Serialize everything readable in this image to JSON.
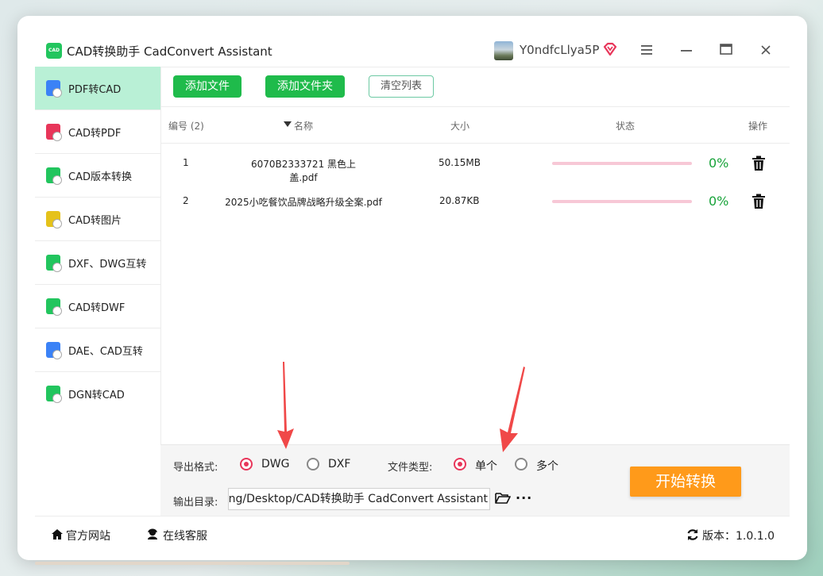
{
  "app": {
    "title": "CAD转换助手 CadConvert Assistant",
    "logo_text": "CAD",
    "username": "Y0ndfcLlya5P"
  },
  "sidebar": {
    "items": [
      {
        "label": "PDF转CAD",
        "icon": "pdf-to-cad-icon",
        "color": "#3b82f6",
        "active": true
      },
      {
        "label": "CAD转PDF",
        "icon": "cad-to-pdf-icon",
        "color": "#e8365a"
      },
      {
        "label": "CAD版本转换",
        "icon": "cad-version-icon",
        "color": "#22c55e"
      },
      {
        "label": "CAD转图片",
        "icon": "cad-to-image-icon",
        "color": "#e5c21a"
      },
      {
        "label": "DXF、DWG互转",
        "icon": "dxf-dwg-icon",
        "color": "#22c55e"
      },
      {
        "label": "CAD转DWF",
        "icon": "cad-to-dwf-icon",
        "color": "#22c55e"
      },
      {
        "label": "DAE、CAD互转",
        "icon": "dae-cad-icon",
        "color": "#3b82f6"
      },
      {
        "label": "DGN转CAD",
        "icon": "dgn-to-cad-icon",
        "color": "#22c55e"
      }
    ]
  },
  "toolbar": {
    "add_file": "添加文件",
    "add_folder": "添加文件夹",
    "clear_list": "清空列表"
  },
  "table": {
    "headers": {
      "index": "编号 (2)",
      "name": "名称",
      "size": "大小",
      "status": "状态",
      "action": "操作"
    },
    "rows": [
      {
        "index": "1",
        "name": "6070B2333721 黑色上盖.pdf",
        "size": "50.15MB",
        "progress": "0%"
      },
      {
        "index": "2",
        "name": "2025小吃餐饮品牌战略升级全案.pdf",
        "size": "20.87KB",
        "progress": "0%"
      }
    ]
  },
  "options": {
    "export_format_label": "导出格式:",
    "formats": [
      "DWG",
      "DXF"
    ],
    "selected_format": "DWG",
    "file_type_label": "文件类型:",
    "file_types": [
      "单个",
      "多个"
    ],
    "selected_file_type": "单个",
    "output_dir_label": "输出目录:",
    "output_dir": "C:/Users/xiaohuang/Desktop/CAD转换助手 CadConvert Assistant",
    "start_button": "开始转换"
  },
  "footer": {
    "website": "官方网站",
    "support": "在线客服",
    "version": "版本：1.0.1.0"
  },
  "colors": {
    "accent_green": "#1fbb4b",
    "selected_red": "#e8365a",
    "start_orange": "#ff9a1a",
    "active_bg": "#b9f0d6",
    "arrow_red": "#f04848"
  }
}
